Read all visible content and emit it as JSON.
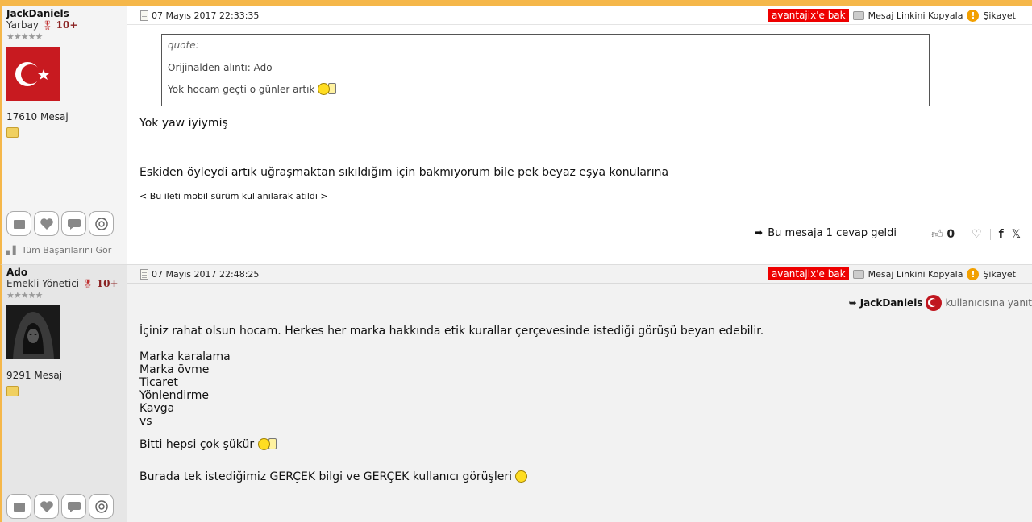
{
  "posts": [
    {
      "user": {
        "name": "JackDaniels",
        "rank": "Yarbay",
        "level": "10+",
        "stars": "★★★★★",
        "message_count": "17610 Mesaj",
        "achievements_label": "Tüm Başarılarını Gör"
      },
      "header": {
        "date": "07 Mayıs 2017 22:33:35",
        "avantaj_label": "avantajix'e bak",
        "copy_link_label": "Mesaj Linkini Kopyala",
        "complaint_label": "Şikayet"
      },
      "quote": {
        "label": "quote:",
        "source": "Orijinalden alıntı: Ado",
        "text": "Yok hocam geçti o günler artık"
      },
      "body": {
        "line1": "Yok yaw iyiymiş",
        "line2": "Eskiden öyleydi artık uğraşmaktan sıkıldığım için bakmıyorum bile pek beyaz eşya konularına",
        "mobile_note": "< Bu ileti mobil sürüm kullanılarak atıldı >"
      },
      "footer": {
        "reply_count_label": "Bu mesaja 1 cevap geldi",
        "likes": "0"
      }
    },
    {
      "user": {
        "name": "Ado",
        "rank": "Emekli Yönetici",
        "level": "10+",
        "stars": "★★★★★",
        "message_count": "9291 Mesaj"
      },
      "header": {
        "date": "07 Mayıs 2017 22:48:25",
        "avantaj_label": "avantajix'e bak",
        "copy_link_label": "Mesaj Linkini Kopyala",
        "complaint_label": "Şikayet"
      },
      "reply_to": {
        "name": "JackDaniels",
        "suffix": "kullanıcısına yanıt"
      },
      "body": {
        "line1": "İçiniz rahat olsun hocam. Herkes her marka hakkında etik kurallar çerçevesinde istediği görüşü beyan edebilir.",
        "list": [
          "Marka karalama",
          "Marka övme",
          "Ticaret",
          "Yönlendirme",
          "Kavga",
          "vs"
        ],
        "line2": "Bitti hepsi çok şükür",
        "line3": "Burada tek istediğimiz GERÇEK bilgi ve GERÇEK kullanıcı görüşleri"
      }
    }
  ],
  "colors": {
    "accent_border": "#f5b74a",
    "avantaj_bg": "#e00000",
    "warning": "#f2a000"
  }
}
